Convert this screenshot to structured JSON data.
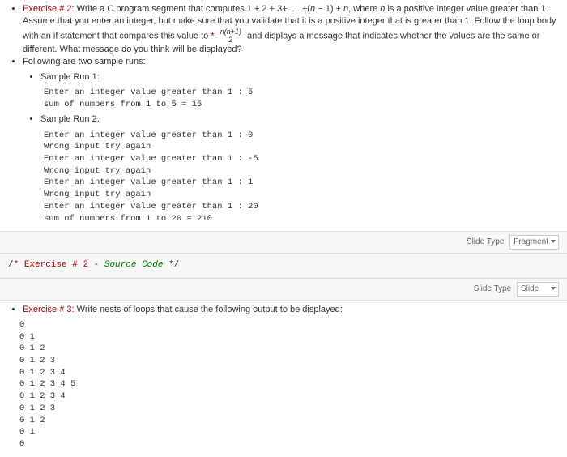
{
  "ex2": {
    "label": "Exercise # 2:",
    "text1": "Write a C program segment that computes 1 + 2 + 3+. . . +(",
    "n": "n",
    "text2": " − 1) + ",
    "text3": ", where ",
    "text4": " is a positive integer value greater than 1. Assume that you enter an integer, but make sure that you validate that it is a positive integer that is greater than 1. Follow the loop body with an if statement that compares this value to ",
    "frac_num": "n(n+1)",
    "frac_den": "2",
    "text5": " and displays a message that indicates whether the values are the same or different. What message do you think will be displayed?"
  },
  "sample_header": "Following are two sample runs:",
  "sample1_label": "Sample Run 1:",
  "sample1_out": "Enter an integer value greater than 1 : 5\nsum of numbers from 1 to 5 = 15",
  "sample2_label": "Sample Run 2:",
  "sample2_out": "Enter an integer value greater than 1 : 0\nWrong input try again\nEnter an integer value greater than 1 : -5\nWrong input try again\nEnter an integer value greater than 1 : 1\nWrong input try again\nEnter an integer value greater than 1 : 20\nsum of numbers from 1 to 20 = 210",
  "slidebar": {
    "label": "Slide Type",
    "fragment": "Fragment",
    "slide": "Slide"
  },
  "codecell": {
    "star": "*",
    "ex_label": "Exercise # 2",
    "sep": " - ",
    "src": "Source Code",
    "end": " */"
  },
  "ex3": {
    "label": "Exercise # 3:",
    "text": "Write nests of loops that cause the following output to be displayed:"
  },
  "ex3_out": "0\n0 1\n0 1 2\n0 1 2 3\n0 1 2 3 4\n0 1 2 3 4 5\n0 1 2 3 4\n0 1 2 3\n0 1 2\n0 1\n0"
}
